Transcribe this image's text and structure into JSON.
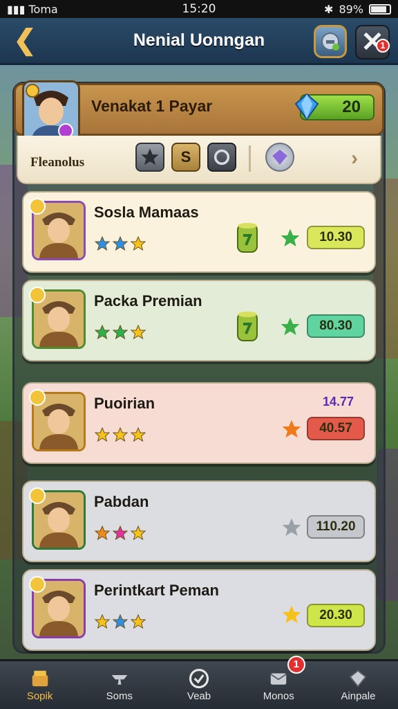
{
  "status_bar": {
    "carrier": "Toma",
    "time": "15:20",
    "battery": "89%"
  },
  "top_bar": {
    "title": "Nenial Uonngan",
    "profile_badge": "",
    "close_badge": "1"
  },
  "header": {
    "title": "Venakat 1 Payar",
    "gem_value": "20"
  },
  "filter": {
    "label": "Fleanolus",
    "buttons": [
      "star",
      "S",
      "ring",
      "gem"
    ]
  },
  "cards": [
    {
      "name": "Sosla Mamaas",
      "price": "10.30",
      "stars": [
        "#2f8fe0",
        "#2f8fe0",
        "#f4c21a"
      ],
      "bg": "#faf2dc",
      "price_bg": "#d9e85a",
      "icon": "barrel",
      "frame": "#8a4cb3"
    },
    {
      "name": "Packa Premian",
      "price": "80.30",
      "stars": [
        "#2bb24a",
        "#2bb24a",
        "#f4c21a"
      ],
      "bg": "#e2ecd6",
      "price_bg": "#5fd3a0",
      "icon": "barrel",
      "frame": "#4f8a2e"
    },
    {
      "name": "Puoirian",
      "price": "40.57",
      "price_old": "14.77",
      "stars": [
        "#f4c21a",
        "#f4c21a",
        "#f4c21a"
      ],
      "bg": "#f6dcd3",
      "price_bg": "#e45a4a",
      "icon": "orange-star",
      "frame": "#b37a1e"
    },
    {
      "name": "Pabdan",
      "price": "110.20",
      "stars": [
        "#f08a1a",
        "#e0349a",
        "#f4c21a"
      ],
      "bg": "#dcdde0",
      "price_bg": "#c4c7cc",
      "icon": "gray-star",
      "frame": "#2f7a3a"
    },
    {
      "name": "Perintkart Peman",
      "price": "20.30",
      "stars": [
        "#f4c21a",
        "#2f8fe0",
        "#f4c21a"
      ],
      "bg": "#dcdde2",
      "price_bg": "#cfe64a",
      "icon": "yellow-star",
      "frame": "#8a3cab"
    }
  ],
  "nav": [
    {
      "label": "Sopik",
      "icon": "shop-icon",
      "active": true
    },
    {
      "label": "Soms",
      "icon": "anvil-icon"
    },
    {
      "label": "Veab",
      "icon": "check-icon"
    },
    {
      "label": "Monos",
      "icon": "mail-icon",
      "badge": "1"
    },
    {
      "label": "Ainpale",
      "icon": "gem-icon"
    }
  ]
}
